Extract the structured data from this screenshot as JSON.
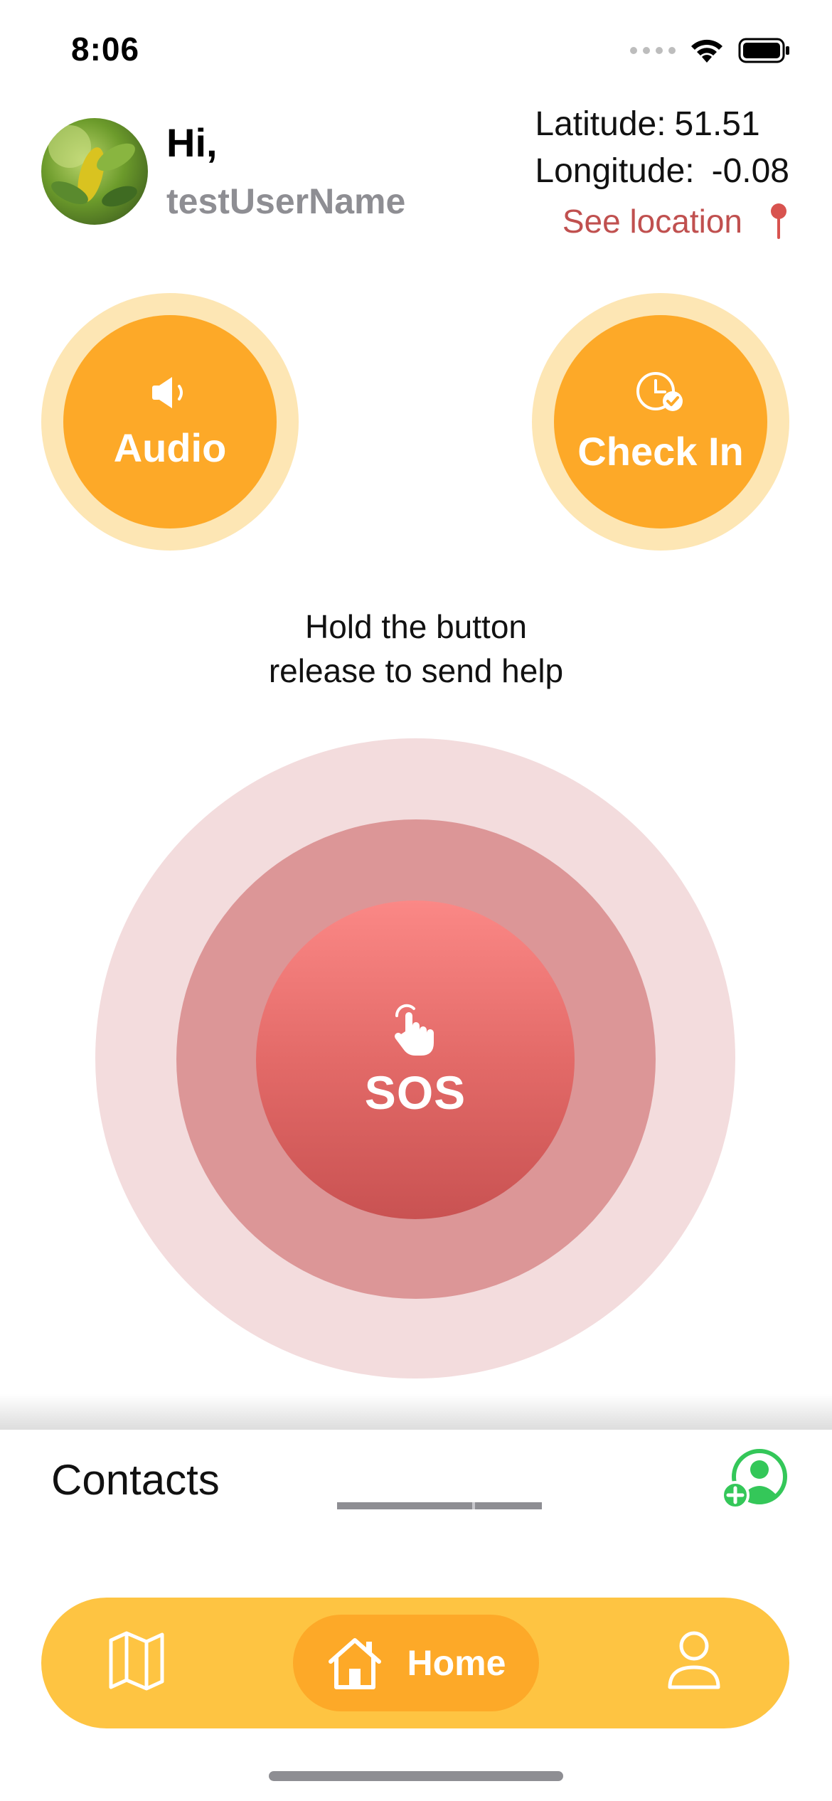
{
  "status_bar": {
    "time": "8:06"
  },
  "header": {
    "greeting": "Hi,",
    "username": "testUserName",
    "latitude_label": "Latitude:",
    "latitude_value": "51.51",
    "longitude_label": "Longitude:",
    "longitude_value": "-0.08",
    "see_location": "See location"
  },
  "actions": {
    "audio_label": "Audio",
    "checkin_label": "Check In"
  },
  "instruction": {
    "line1": "Hold the button",
    "line2": "release to send help"
  },
  "sos": {
    "label": "SOS"
  },
  "contacts": {
    "title": "Contacts"
  },
  "tabbar": {
    "items": [
      {
        "name": "map",
        "icon": "map-icon",
        "label": ""
      },
      {
        "name": "home",
        "icon": "house-icon",
        "label": "Home"
      },
      {
        "name": "profile",
        "icon": "person-icon",
        "label": ""
      }
    ],
    "active": "home"
  },
  "colors": {
    "orange": "#fda928",
    "orange_light": "#fde6b4",
    "tabbar": "#fec442",
    "sos_outer": "#f3dcdd",
    "sos_mid": "#dc9697",
    "sos_inner": "#e36a68",
    "location_red": "#c0504f",
    "add_contact_green": "#34c759"
  }
}
